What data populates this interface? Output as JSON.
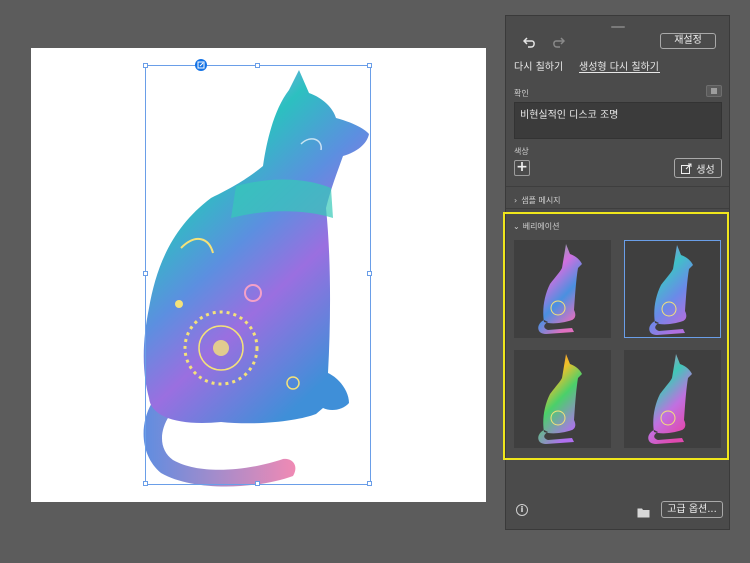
{
  "toolbar": {
    "reset_label": "재설정",
    "undo_icon": "undo-icon",
    "redo_icon": "redo-icon"
  },
  "tabs": [
    {
      "label": "다시 칠하기",
      "active": false
    },
    {
      "label": "생성형 다시 칠하기",
      "active": true
    }
  ],
  "prompt": {
    "label": "확인",
    "value": "비현실적인 디스코 조명"
  },
  "color": {
    "label": "색상",
    "add_icon": "plus-icon",
    "generate_label": "생성"
  },
  "sample_prompts": {
    "label": "샘플 메시지",
    "expanded": false
  },
  "variations": {
    "label": "베리에이션",
    "expanded": true,
    "selected_index": 1,
    "count": 4
  },
  "footer": {
    "info_icon": "info-icon",
    "folder_icon": "folder-icon",
    "advanced_label": "고급 옵션..."
  },
  "colors": {
    "accent": "#1473e6",
    "highlight": "#f0e61c",
    "panel": "#4b4b4b"
  }
}
